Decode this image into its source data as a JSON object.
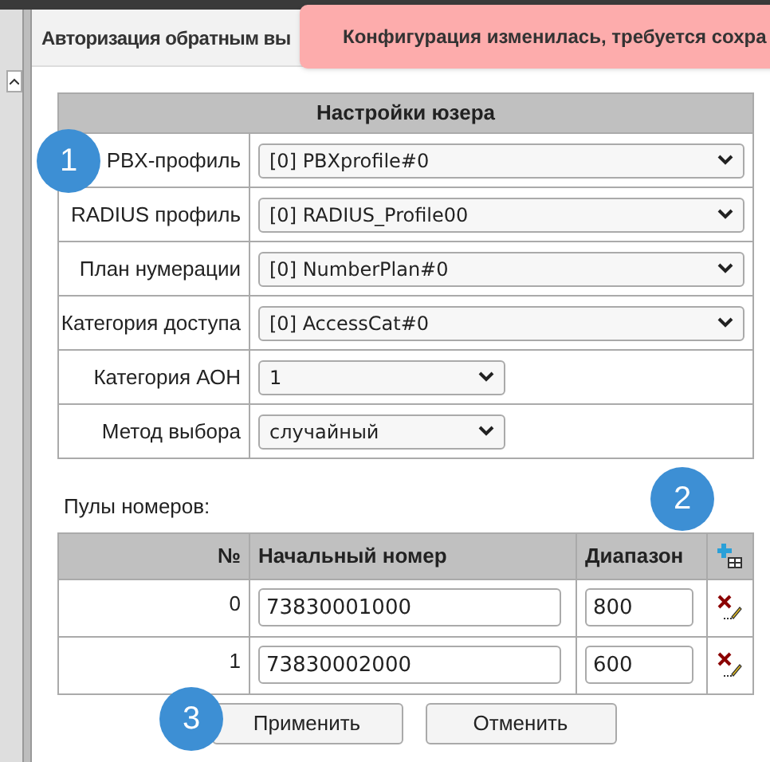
{
  "page_title": "Авторизация обратным вы",
  "toast": "Конфигурация изменилась, требуется сохра",
  "settings": {
    "title": "Настройки юзера",
    "rows": [
      {
        "label": "PBX-профиль",
        "value": "[0] PBXprofile#0",
        "wide": true
      },
      {
        "label": "RADIUS профиль",
        "value": "[0] RADIUS_Profile00",
        "wide": true
      },
      {
        "label": "План нумерации",
        "value": "[0] NumberPlan#0",
        "wide": true
      },
      {
        "label": "Категория доступа",
        "value": "[0] AccessCat#0",
        "wide": true
      },
      {
        "label": "Категория АОН",
        "value": "1",
        "wide": false
      },
      {
        "label": "Метод выбора",
        "value": "случайный",
        "wide": false
      }
    ]
  },
  "pools": {
    "title": "Пулы номеров:",
    "columns": [
      "№",
      "Начальный номер",
      "Диапазон"
    ],
    "rows": [
      {
        "index": "0",
        "start": "73830001000",
        "range": "800"
      },
      {
        "index": "1",
        "start": "73830002000",
        "range": "600"
      }
    ]
  },
  "buttons": [
    "Применить",
    "Отменить"
  ],
  "badges": [
    "1",
    "2",
    "3"
  ]
}
